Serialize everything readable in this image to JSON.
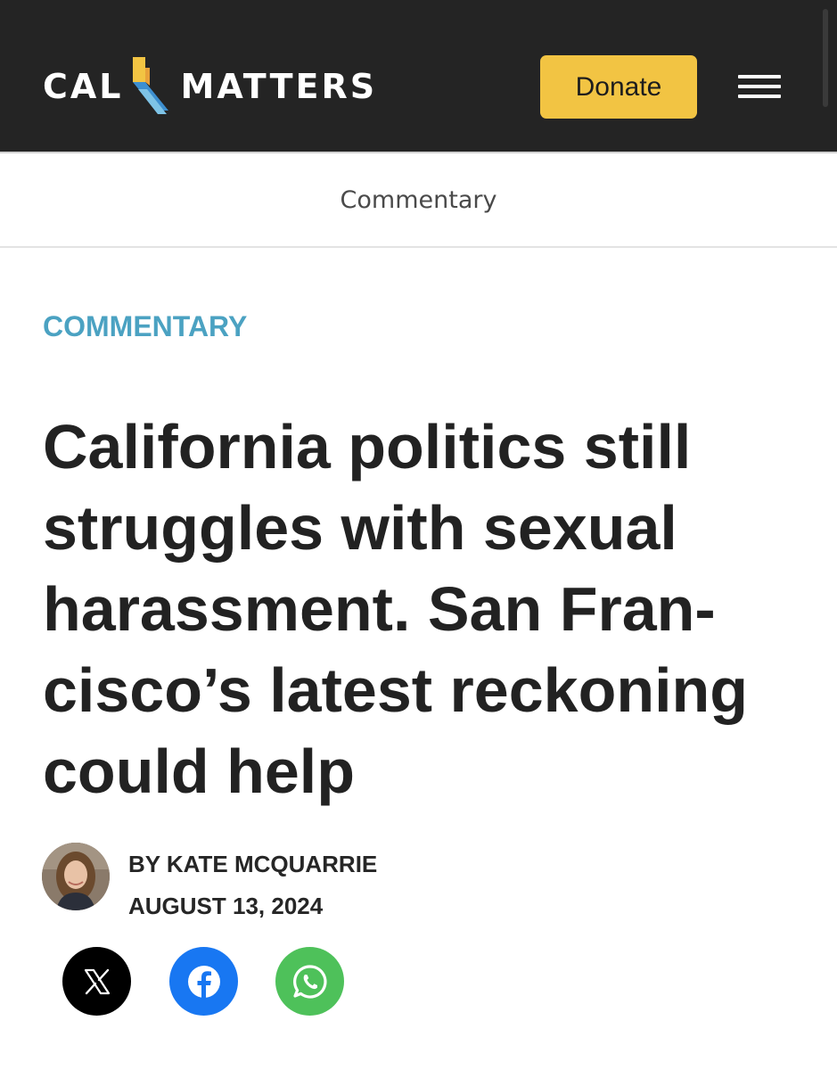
{
  "header": {
    "logo": {
      "left": "CAL",
      "right": "MATTERS"
    },
    "donate_label": "Donate",
    "menu_icon": "hamburger-menu-icon",
    "brand_colors": {
      "background": "#242424",
      "donate": "#f2c443"
    }
  },
  "section_nav": {
    "label": "Commentary"
  },
  "article": {
    "kicker": "COMMENTARY",
    "kicker_color": "#4ba2c2",
    "headline_lines": [
      "California politics still",
      "struggles with sexual",
      "harassment. San Fran-",
      "cisco’s latest reckoning",
      "could help"
    ],
    "byline": "BY KATE MCQUARRIE",
    "date": "AUGUST 13, 2024",
    "author_avatar": "author-photo"
  },
  "share": [
    {
      "network": "x",
      "icon": "x-logo-icon",
      "color": "#000000"
    },
    {
      "network": "facebook",
      "icon": "facebook-icon",
      "color": "#1877f2"
    },
    {
      "network": "whatsapp",
      "icon": "whatsapp-icon",
      "color": "#4ec15a"
    }
  ]
}
